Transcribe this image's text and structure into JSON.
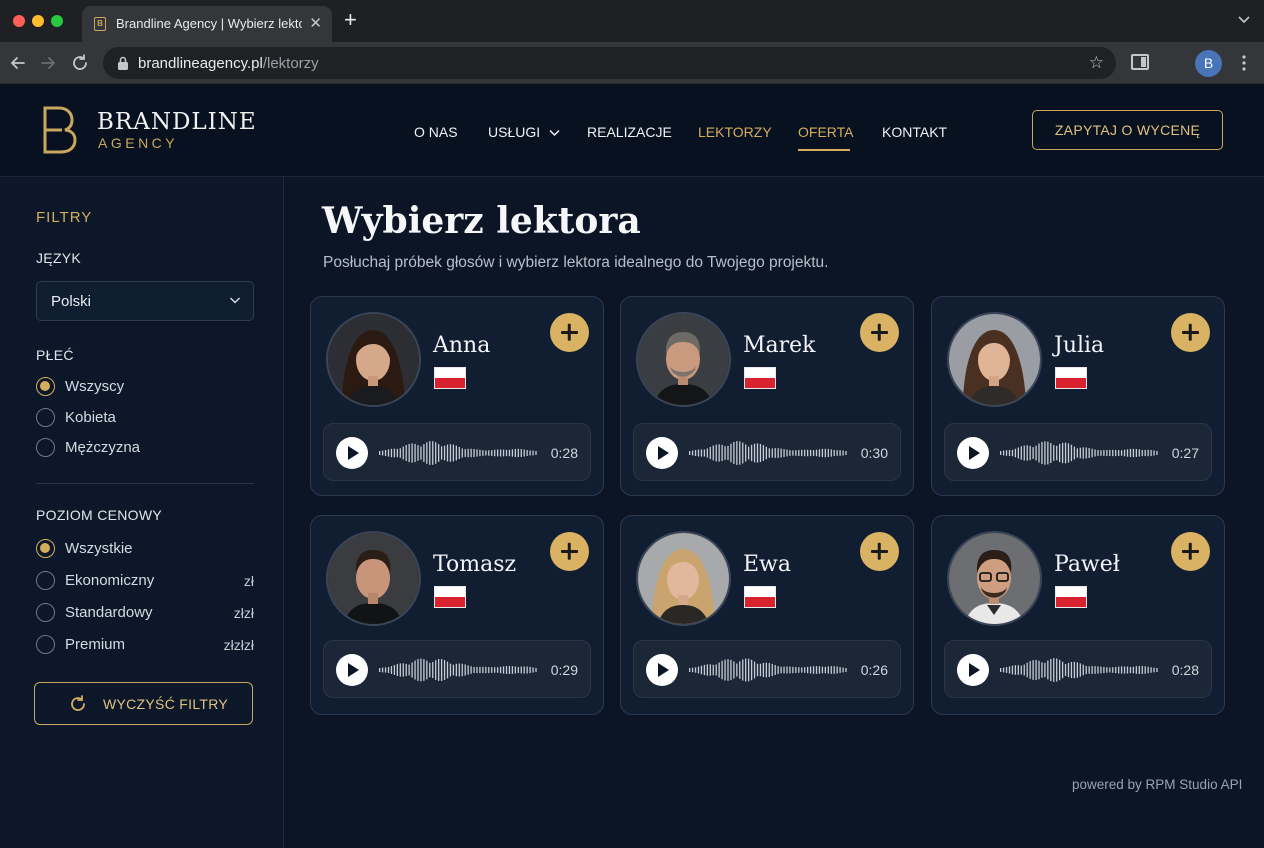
{
  "browser": {
    "tab_title": "Brandline Agency | Wybierz lektora",
    "url_host": "brandlineagency.pl",
    "url_path": "/lektorzy",
    "profile_initial": "B",
    "window_dot_colors": [
      "#ff5f57",
      "#febc2e",
      "#28c840"
    ]
  },
  "header": {
    "brand": "BRANDLINE",
    "brand_sub": "AGENCY",
    "nav": [
      {
        "label": "O NAS"
      },
      {
        "label": "USŁUGI"
      },
      {
        "label": "REALIZACJE"
      },
      {
        "label": "LEKTORZY"
      },
      {
        "label": "OFERTA"
      },
      {
        "label": "KONTAKT"
      }
    ],
    "cta": "ZAPYTAJ O WYCENĘ"
  },
  "filters": {
    "title": "FILTRY",
    "language_label": "JĘZYK",
    "language_value": "Polski",
    "gender_label": "PŁEĆ",
    "gender_options": [
      {
        "label": "Wszyscy",
        "selected": true
      },
      {
        "label": "Kobieta",
        "selected": false
      },
      {
        "label": "Mężczyzna",
        "selected": false
      }
    ],
    "price_label": "POZIOM CENOWY",
    "price_options": [
      {
        "label": "Wszystkie",
        "tag": "",
        "selected": true
      },
      {
        "label": "Ekonomiczny",
        "tag": "zł",
        "selected": false
      },
      {
        "label": "Standardowy",
        "tag": "złzł",
        "selected": false
      },
      {
        "label": "Premium",
        "tag": "złzłzł",
        "selected": false
      }
    ],
    "clear_label": "WYCZYŚĆ FILTRY"
  },
  "main": {
    "title": "Wybierz lektora",
    "subtitle": "Posłuchaj próbek głosów i wybierz lektora idealnego do Twojego projektu."
  },
  "voices": [
    {
      "name": "Anna",
      "duration": "0:28"
    },
    {
      "name": "Marek",
      "duration": "0:30"
    },
    {
      "name": "Julia",
      "duration": "0:27"
    },
    {
      "name": "Tomasz",
      "duration": "0:29"
    },
    {
      "name": "Ewa",
      "duration": "0:26"
    },
    {
      "name": "Paweł",
      "duration": "0:28"
    }
  ],
  "footer": {
    "powered": "powered by RPM Studio API"
  },
  "colors": {
    "accent": "#d4ad5f",
    "background": "#0b1525",
    "card": "#111d30",
    "flag_red": "#d8222f"
  }
}
